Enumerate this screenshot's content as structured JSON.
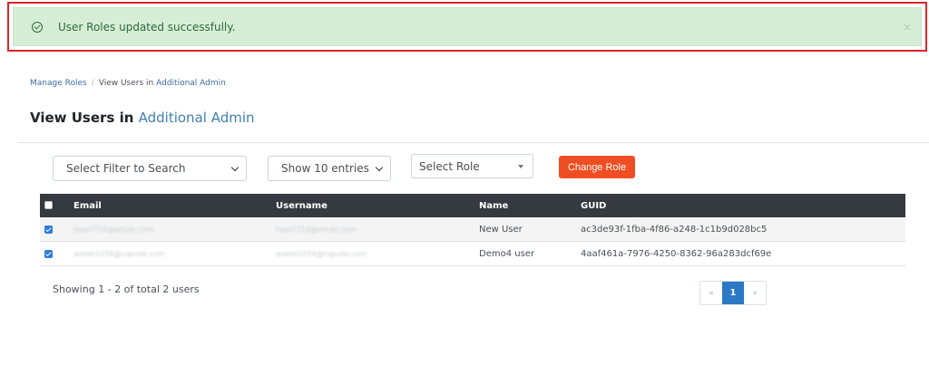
{
  "alert": {
    "message": "User Roles updated successfully.",
    "close_label": "×"
  },
  "breadcrumb": {
    "root": "Manage Roles",
    "separator": "/",
    "current_prefix": "View Users in",
    "current_role": "Additional Admin"
  },
  "page": {
    "title_prefix": "View Users in",
    "title_role": "Additional Admin"
  },
  "filters": {
    "search_filter": "Select Filter to Search",
    "entries": "Show 10 entries",
    "role": "Select Role",
    "change_role_label": "Change Role"
  },
  "table": {
    "columns": [
      "Email",
      "Username",
      "Name",
      "GUID"
    ],
    "rows": [
      {
        "selected": true,
        "email": "lope7710@artubi.com",
        "username": "lope7710@artubi.com",
        "name": "New User",
        "guid": "ac3de93f-1fba-4f86-a248-1c1b9d028bc5"
      },
      {
        "selected": true,
        "email": "waket1034@rupude.com",
        "username": "waket1034@rupude.com",
        "name": "Demo4 user",
        "guid": "4aaf461a-7976-4250-8362-96a283dcf69e"
      }
    ]
  },
  "footer": {
    "summary": "Showing 1 - 2 of total 2 users"
  },
  "pagination": {
    "prev": "«",
    "current": "1",
    "next": "»"
  },
  "colors": {
    "accent": "#ef4e22",
    "success_bg": "#d6eed6",
    "header_bg": "#343a40",
    "link": "#3f7fb0"
  }
}
